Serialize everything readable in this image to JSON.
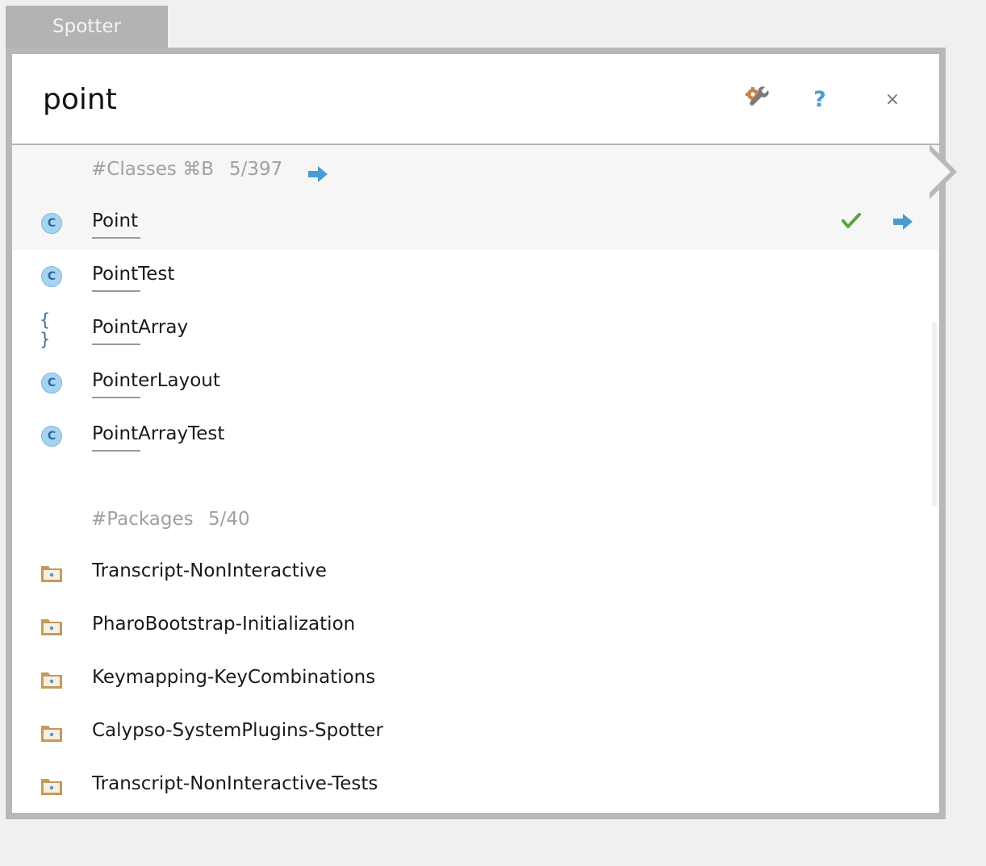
{
  "window_tab": {
    "title": "Spotter"
  },
  "search": {
    "query": "point"
  },
  "toolbar": {
    "settings_icon": "wrench-gear-icon",
    "help_label": "?",
    "close_label": "×"
  },
  "groups": {
    "classes": {
      "title": "#Classes ⌘B",
      "count": "5/397",
      "items": [
        {
          "label": "Point",
          "icon": "class-icon",
          "icon_glyph": "C"
        },
        {
          "label": "PointTest",
          "icon": "class-icon",
          "icon_glyph": "C"
        },
        {
          "label": "PointArray",
          "icon": "trait-icon",
          "icon_glyph": "{ }"
        },
        {
          "label": "PointerLayout",
          "icon": "class-icon",
          "icon_glyph": "C"
        },
        {
          "label": "PointArrayTest",
          "icon": "class-icon",
          "icon_glyph": "C"
        }
      ]
    },
    "packages": {
      "title": "#Packages",
      "count": "5/40",
      "items": [
        {
          "label": "Transcript-NonInteractive",
          "icon": "package-folder-icon"
        },
        {
          "label": "PharoBootstrap-Initialization",
          "icon": "package-folder-icon"
        },
        {
          "label": "Keymapping-KeyCombinations",
          "icon": "package-folder-icon"
        },
        {
          "label": "Calypso-SystemPlugins-Spotter",
          "icon": "package-folder-icon"
        },
        {
          "label": "Transcript-NonInteractive-Tests",
          "icon": "package-folder-icon"
        }
      ]
    }
  },
  "colors": {
    "accent_blue": "#4a9cd0",
    "check_green": "#5ba244",
    "package_folder": "#c49a5a",
    "frame_gray": "#b8b8b8"
  }
}
